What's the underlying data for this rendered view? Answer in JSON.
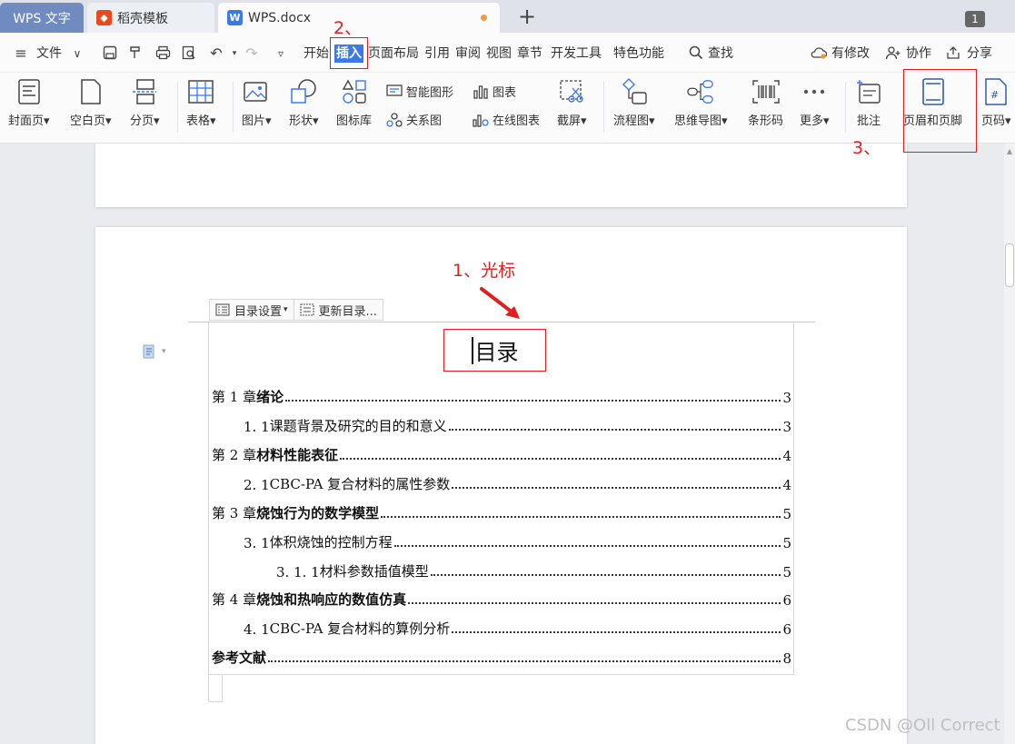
{
  "tabs": {
    "wps": "WPS 文字",
    "daoke": "稻壳模板",
    "doc": "WPS.docx",
    "window_count": "1"
  },
  "menu": {
    "file": "文件",
    "start": "开始",
    "insert": "插入",
    "layout": "页面布局",
    "reference": "引用",
    "review": "审阅",
    "view": "视图",
    "chapter": "章节",
    "dev": "开发工具",
    "special": "特色功能",
    "find": "查找",
    "changes": "有修改",
    "collab": "协作",
    "share": "分享"
  },
  "ribbon": {
    "cover": "封面页",
    "blank": "空白页",
    "pagebreak": "分页",
    "table": "表格",
    "picture": "图片",
    "shape": "形状",
    "iconlib": "图标库",
    "smartart": "智能图形",
    "chart": "图表",
    "relation": "关系图",
    "onlinechart": "在线图表",
    "screenshot": "截屏",
    "flowchart": "流程图",
    "mindmap": "思维导图",
    "barcode": "条形码",
    "more": "更多",
    "comment": "批注",
    "headerfooter": "页眉和页脚",
    "pagenum": "页码"
  },
  "annotations": {
    "step1": "1、光标",
    "step2": "2、",
    "step3": "3、"
  },
  "toc_toolbar": {
    "settings": "目录设置",
    "update": "更新目录..."
  },
  "toc": {
    "title": "目录",
    "entries": [
      {
        "num": "第 1 章 ",
        "title": "绪论",
        "page": "3"
      },
      {
        "num": "1. 1 ",
        "title": "课题背景及研究的目的和意义",
        "page": "3"
      },
      {
        "num": "第 2 章 ",
        "title": "材料性能表征",
        "page": "4"
      },
      {
        "num": "2. 1 ",
        "title": "CBC-PA 复合材料的属性参数",
        "page": "4"
      },
      {
        "num": "第 3 章 ",
        "title": "烧蚀行为的数学模型",
        "page": "5"
      },
      {
        "num": "3. 1 ",
        "title": "体积烧蚀的控制方程",
        "page": "5"
      },
      {
        "num": "3. 1. 1 ",
        "title": "材料参数插值模型",
        "page": "5"
      },
      {
        "num": "第 4 章 ",
        "title": "烧蚀和热响应的数值仿真",
        "page": "6"
      },
      {
        "num": "4. 1 ",
        "title": "CBC-PA 复合材料的算例分析",
        "page": "6"
      },
      {
        "num": "",
        "title": "参考文献",
        "page": "8"
      }
    ]
  },
  "watermark": "CSDN @Oll Correct",
  "colors": {
    "accent": "#3c7ae6",
    "annotation_red": "#e02020",
    "wps_tab": "#6f8bc0"
  }
}
